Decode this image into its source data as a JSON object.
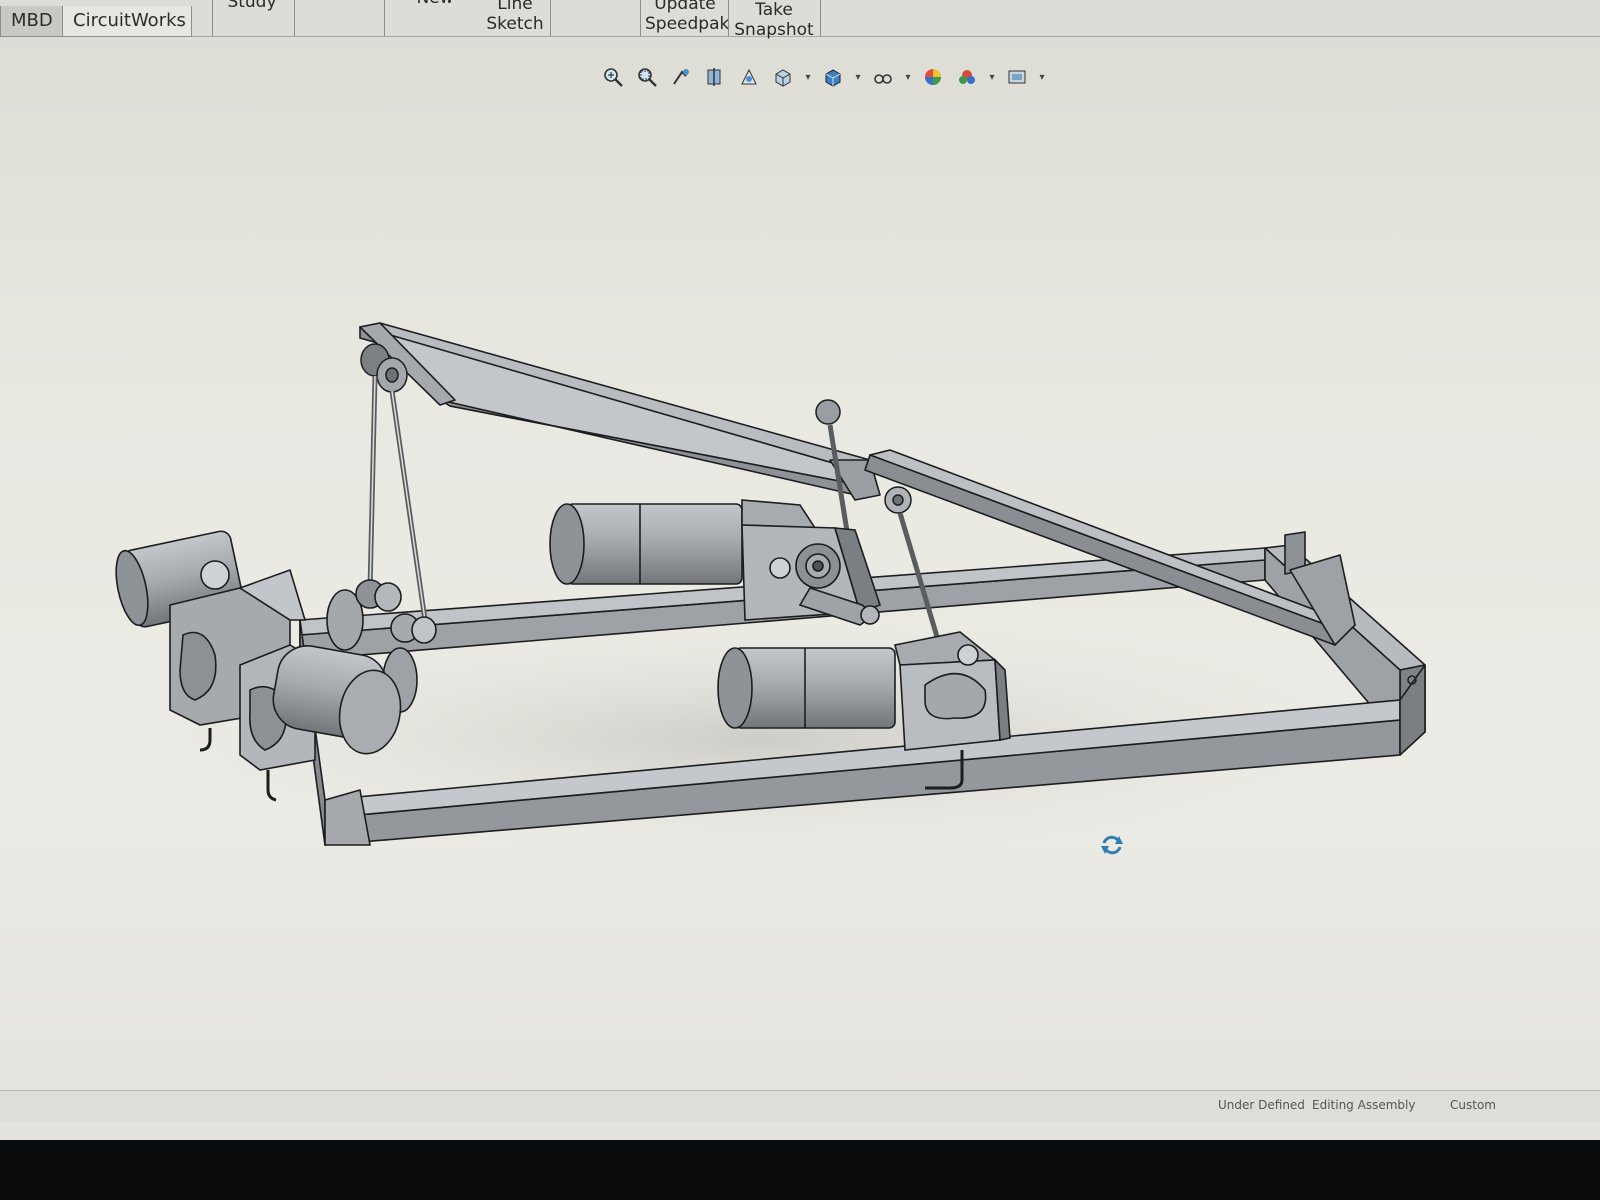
{
  "ribbon": {
    "groups": [
      {
        "id": "study",
        "label": "Study"
      },
      {
        "id": "new",
        "label": "New"
      },
      {
        "id": "line_sketch",
        "line1": "Line",
        "line2": "Sketch"
      },
      {
        "id": "update_speedpak",
        "line1": "Update",
        "line2": "Speedpak"
      },
      {
        "id": "take_snapshot",
        "line1": "Take",
        "line2": "Snapshot"
      }
    ]
  },
  "tabs": [
    {
      "label": "MBD"
    },
    {
      "label": "CircuitWorks"
    }
  ],
  "heads_up_toolbar": {
    "icons": [
      "zoom-to-fit-icon",
      "zoom-to-area-icon",
      "previous-view-icon",
      "section-view-icon",
      "dynamic-annotation-icon",
      "view-orientation-icon",
      "display-style-icon",
      "hide-show-items-icon",
      "edit-appearance-icon",
      "apply-scene-icon",
      "view-settings-icon"
    ]
  },
  "status": {
    "under_defined": "Under Defined",
    "editing": "Editing Assembly",
    "units": "Custom"
  },
  "colors": {
    "part_fill": "#a3a7ab",
    "part_dark": "#6f7377",
    "edge": "#1c1d1e",
    "background": "#e9e8e1"
  }
}
